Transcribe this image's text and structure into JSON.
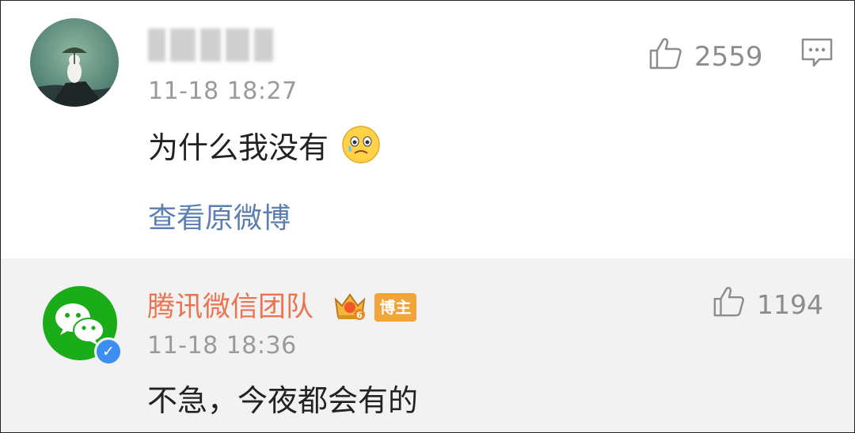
{
  "comment": {
    "username_blurred": true,
    "timestamp": "11-18 18:27",
    "text": "为什么我没有",
    "emoji": "crying-face-emoji",
    "likes": "2559",
    "view_original": "查看原微博"
  },
  "reply": {
    "username": "腾讯微信团队",
    "badge": "博主",
    "crown_level": "6",
    "timestamp": "11-18 18:36",
    "text": "不急，今夜都会有的",
    "likes": "1194"
  },
  "colors": {
    "reply_name": "#eb7350",
    "link": "#5b7fb0",
    "wechat_green": "#1aad19",
    "verified_blue": "#3d8ef3"
  }
}
